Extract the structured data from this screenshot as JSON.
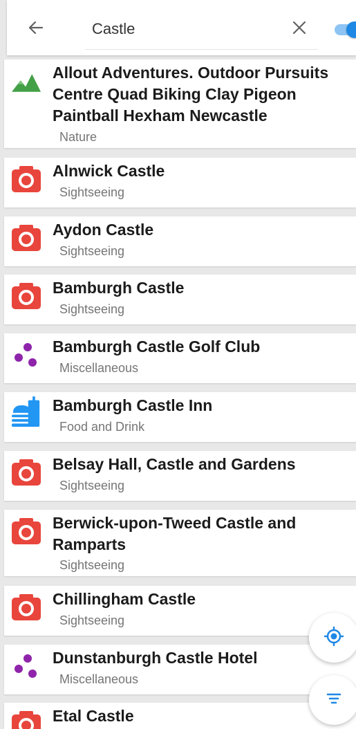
{
  "search": {
    "value": "Castle"
  },
  "toggle": {
    "on": true
  },
  "colors": {
    "accent": "#1e88e5",
    "sightseeing": "#e8453c",
    "nature": "#43a047",
    "misc": "#8e24aa",
    "food": "#2196f3"
  },
  "results": [
    {
      "title": "Allout Adventures. Outdoor Pursuits Centre Quad Biking Clay Pigeon Paintball Hexham Newcastle",
      "category": "Nature",
      "icon": "mountain-icon"
    },
    {
      "title": "Alnwick Castle",
      "category": "Sightseeing",
      "icon": "camera-icon"
    },
    {
      "title": "Aydon Castle",
      "category": "Sightseeing",
      "icon": "camera-icon"
    },
    {
      "title": "Bamburgh Castle",
      "category": "Sightseeing",
      "icon": "camera-icon"
    },
    {
      "title": "Bamburgh Castle Golf Club",
      "category": "Miscellaneous",
      "icon": "dots-icon"
    },
    {
      "title": "Bamburgh Castle Inn",
      "category": "Food and Drink",
      "icon": "burger-drink-icon"
    },
    {
      "title": "Belsay Hall, Castle and Gardens",
      "category": "Sightseeing",
      "icon": "camera-icon"
    },
    {
      "title": "Berwick-upon-Tweed Castle and Ramparts",
      "category": "Sightseeing",
      "icon": "camera-icon"
    },
    {
      "title": "Chillingham Castle",
      "category": "Sightseeing",
      "icon": "camera-icon"
    },
    {
      "title": "Dunstanburgh Castle Hotel",
      "category": "Miscellaneous",
      "icon": "dots-icon"
    },
    {
      "title": "Etal Castle",
      "category": "",
      "icon": "camera-icon"
    }
  ],
  "fabs": {
    "locate": "locate-icon",
    "filter": "filter-icon"
  }
}
